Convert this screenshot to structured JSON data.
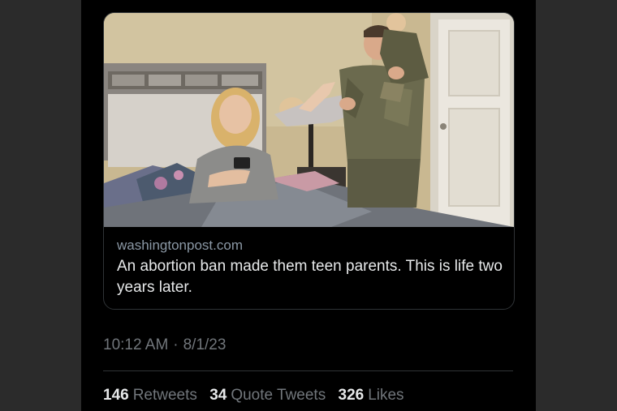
{
  "card": {
    "domain": "washingtonpost.com",
    "title": "An abortion ban made them teen parents. This is life two years later."
  },
  "tweet": {
    "time": "10:12 AM",
    "separator": "·",
    "date": "8/1/23"
  },
  "stats": {
    "retweets_count": "146",
    "retweets_label": "Retweets",
    "quote_tweets_count": "34",
    "quote_tweets_label": "Quote Tweets",
    "likes_count": "326",
    "likes_label": "Likes"
  }
}
